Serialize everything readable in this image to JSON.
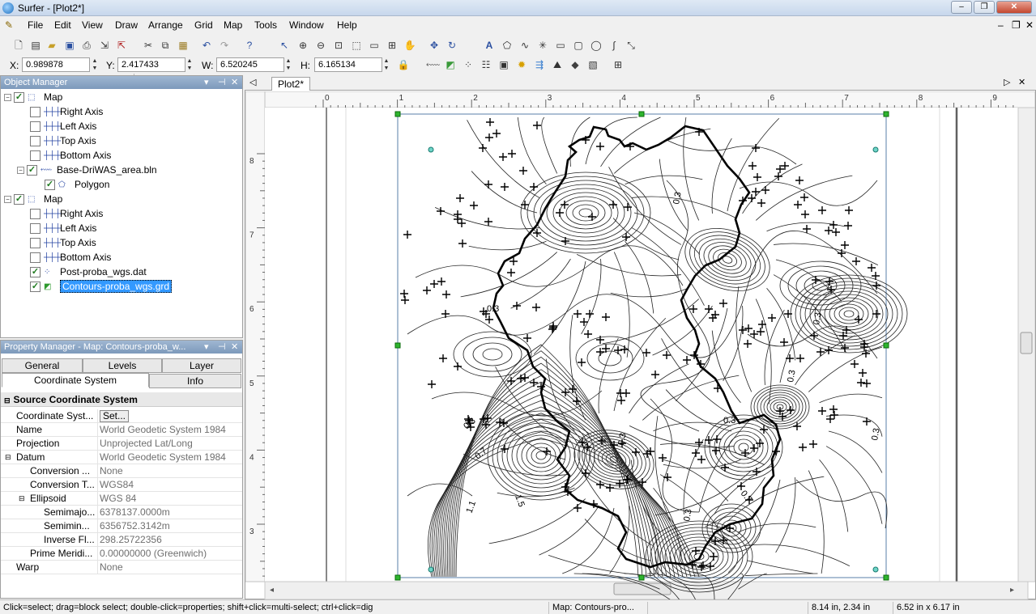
{
  "window": {
    "title": "Surfer - [Plot2*]"
  },
  "menu": [
    "File",
    "Edit",
    "View",
    "Draw",
    "Arrange",
    "Grid",
    "Map",
    "Tools",
    "Window",
    "Help"
  ],
  "coords": {
    "x_label": "X:",
    "x": "0.989878",
    "y_label": "Y:",
    "y": "2.417433",
    "w_label": "W:",
    "w": "6.520245",
    "h_label": "H:",
    "h": "6.165134"
  },
  "object_manager": {
    "title": "Object Manager",
    "items": [
      {
        "label": "Map",
        "icon": "map-frame-icon",
        "checked": true
      },
      {
        "label": "Right Axis",
        "icon": "axis-icon",
        "checked": false
      },
      {
        "label": "Left Axis",
        "icon": "axis-icon",
        "checked": false
      },
      {
        "label": "Top Axis",
        "icon": "axis-icon",
        "checked": false
      },
      {
        "label": "Bottom Axis",
        "icon": "axis-icon",
        "checked": false
      },
      {
        "label": "Base-DriWAS_area.bln",
        "icon": "base-map-icon",
        "checked": true
      },
      {
        "label": "Polygon",
        "icon": "polygon-icon",
        "checked": true
      },
      {
        "label": "Map",
        "icon": "map-frame-icon",
        "checked": true
      },
      {
        "label": "Right Axis",
        "icon": "axis-icon",
        "checked": false
      },
      {
        "label": "Left Axis",
        "icon": "axis-icon",
        "checked": false
      },
      {
        "label": "Top Axis",
        "icon": "axis-icon",
        "checked": false
      },
      {
        "label": "Bottom Axis",
        "icon": "axis-icon",
        "checked": false
      },
      {
        "label": "Post-proba_wgs.dat",
        "icon": "post-map-icon",
        "checked": true
      },
      {
        "label": "Contours-proba_wgs.grd",
        "icon": "contour-map-icon",
        "checked": true
      }
    ]
  },
  "property_manager": {
    "title": "Property Manager - Map: Contours-proba_w...",
    "tabs": [
      "General",
      "Levels",
      "Layer",
      "Coordinate System",
      "Info"
    ],
    "section": "Source Coordinate System",
    "rows": [
      {
        "key": "Coordinate Syst...",
        "value": "Set..."
      },
      {
        "key": "Name",
        "value": "World Geodetic System 1984"
      },
      {
        "key": "Projection",
        "value": "Unprojected Lat/Long"
      },
      {
        "key": "Datum",
        "value": "World Geodetic System 1984"
      },
      {
        "key": "Conversion ...",
        "value": "None"
      },
      {
        "key": "Conversion T...",
        "value": "WGS84"
      },
      {
        "key": "Ellipsoid",
        "value": "WGS 84"
      },
      {
        "key": "Semimajo...",
        "value": "6378137.0000m"
      },
      {
        "key": "Semimin...",
        "value": "6356752.3142m"
      },
      {
        "key": "Inverse Fl...",
        "value": "298.25722356"
      },
      {
        "key": "Prime Meridi...",
        "value": "0.00000000 (Greenwich)"
      },
      {
        "key": "Warp",
        "value": "None"
      }
    ]
  },
  "document": {
    "tab": "Plot2*",
    "ruler_top": [
      "0",
      "1",
      "2",
      "3",
      "4",
      "5",
      "6",
      "7",
      "8",
      "9"
    ],
    "ruler_left": [
      "8",
      "7",
      "6",
      "5",
      "4",
      "3"
    ],
    "contour_labels": [
      "0.3",
      "0.3",
      "0.3",
      "0.3",
      "0.3",
      "0.3",
      "0.3",
      "0.3",
      "0.7",
      "1.5",
      "1.1",
      "0.7",
      "0.3"
    ]
  },
  "status": {
    "hint": "Click=select; drag=block select; double-click=properties; shift+click=multi-select; ctrl+click=dig",
    "selection": "Map: Contours-pro...",
    "cursor": "8.14 in, 2.34 in",
    "size": "6.52 in x 6.17 in"
  }
}
